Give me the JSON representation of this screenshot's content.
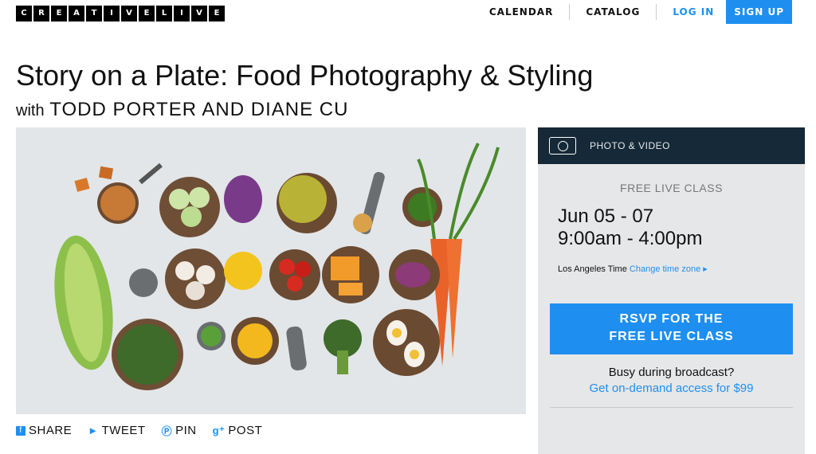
{
  "header": {
    "logo_letters": [
      "C",
      "R",
      "E",
      "A",
      "T",
      "I",
      "V",
      "E",
      "L",
      "I",
      "V",
      "E"
    ],
    "nav": {
      "calendar": "CALENDAR",
      "catalog": "CATALOG",
      "login": "LOG IN",
      "signup": "SIGN UP"
    }
  },
  "course": {
    "title": "Story on a Plate: Food Photography & Styling",
    "with": "with",
    "instructors": "TODD PORTER AND DIANE CU"
  },
  "share": {
    "share": "SHARE",
    "tweet": "TWEET",
    "pin": "PIN",
    "post": "POST"
  },
  "panel": {
    "category": "PHOTO & VIDEO",
    "class_type": "FREE LIVE CLASS",
    "dates": "Jun 05 - 07",
    "time": "9:00am - 4:00pm",
    "timezone": "Los Angeles Time",
    "change_timezone": "Change time zone",
    "rsvp_line1": "RSVP FOR THE",
    "rsvp_line2": "FREE LIVE CLASS",
    "busy": "Busy during broadcast?",
    "ondemand": "Get on-demand access for $99"
  },
  "colors": {
    "accent": "#1e8ff0",
    "panel_header": "#152938",
    "panel_bg": "#e6e7e8"
  }
}
